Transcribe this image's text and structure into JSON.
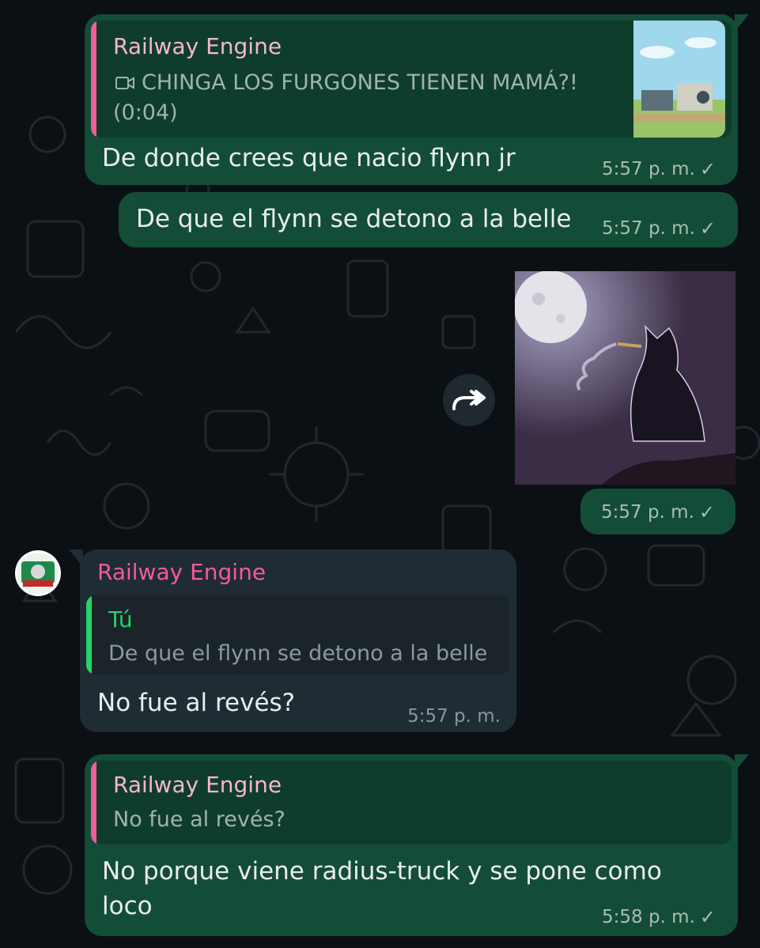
{
  "colors": {
    "outgoing_bubble": "#144d37",
    "incoming_bubble": "#202c33",
    "sender_name_color": "#f15c9a",
    "self_reply_color": "#25d366",
    "background": "#0b1014"
  },
  "messages": [
    {
      "direction": "outgoing",
      "reply": {
        "author": "Railway Engine",
        "icon": "video-camera-icon",
        "text": "CHINGA LOS FURGONES TIENEN MAMÁ?! (0:04)",
        "thumbnail": "cartoon-train-scene"
      },
      "text": "De donde crees que nacio flynn jr",
      "time": "5:57 p. m.",
      "status": "sent-check"
    },
    {
      "direction": "outgoing",
      "text": "De que el flynn se detono a la belle",
      "time": "5:57 p. m.",
      "status": "sent-check"
    },
    {
      "direction": "outgoing",
      "type": "image",
      "image": "cat-smoking-under-full-moon",
      "forward_icon": "forward-arrow-icon",
      "time": "5:57 p. m.",
      "status": "sent-check"
    },
    {
      "direction": "incoming",
      "sender": "Railway Engine",
      "avatar": "green-train-avatar",
      "reply": {
        "author": "Tú",
        "text": "De que el flynn se detono a la belle"
      },
      "text": "No fue al revés?",
      "time": "5:57 p. m."
    },
    {
      "direction": "outgoing",
      "reply": {
        "author": "Railway Engine",
        "text": "No fue al revés?"
      },
      "text": "No porque viene radius-truck y se pone como loco",
      "time": "5:58 p. m.",
      "status": "sent-check"
    }
  ]
}
